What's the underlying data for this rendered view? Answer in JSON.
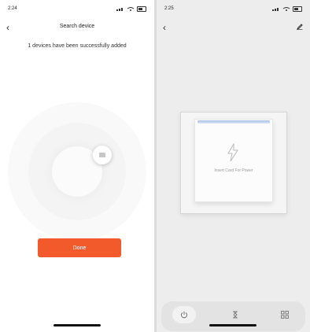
{
  "left_screen": {
    "time": "2:24",
    "nav_title": "Search device",
    "back_glyph": "‹",
    "success_message": "1 devices have been successfully added",
    "done_button": "Done",
    "accent_color": "#f25a2c"
  },
  "right_screen": {
    "time": "2:25",
    "back_glyph": "‹",
    "edit_icon": "pencil-icon",
    "card_prompt": "Insert Card For Power",
    "card_icon": "lightning-bolt-icon",
    "tabs": [
      {
        "icon": "power-icon",
        "selected": true
      },
      {
        "icon": "hourglass-icon",
        "selected": false
      },
      {
        "icon": "grid-icon",
        "selected": false
      }
    ]
  }
}
